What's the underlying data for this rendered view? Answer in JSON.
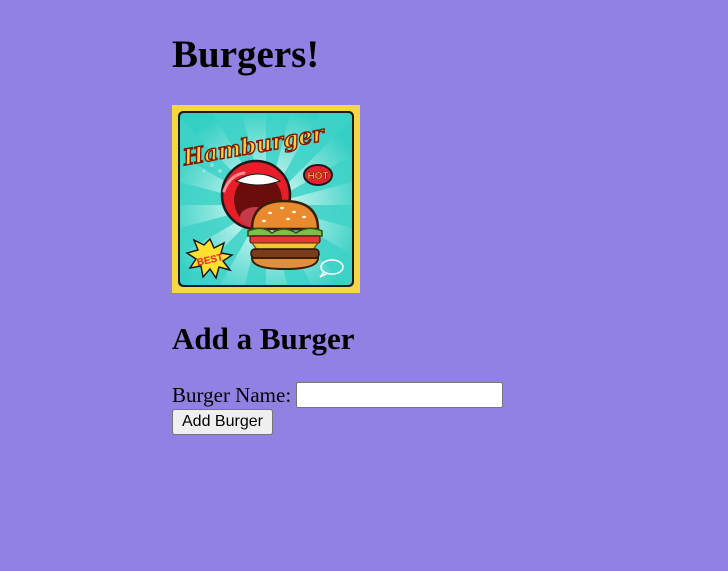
{
  "page": {
    "title": "Burgers!",
    "background_color": "#9181e2"
  },
  "hero_image": {
    "headline": "Hamburger",
    "badge_hot": "HOT",
    "badge_best": "BEST",
    "frame_color": "#f5d742",
    "ray_colors": [
      "#3ed3c8",
      "#bdf5e6"
    ]
  },
  "add_section": {
    "heading": "Add a Burger",
    "name_label": "Burger Name:",
    "name_value": "",
    "submit_label": "Add Burger"
  }
}
